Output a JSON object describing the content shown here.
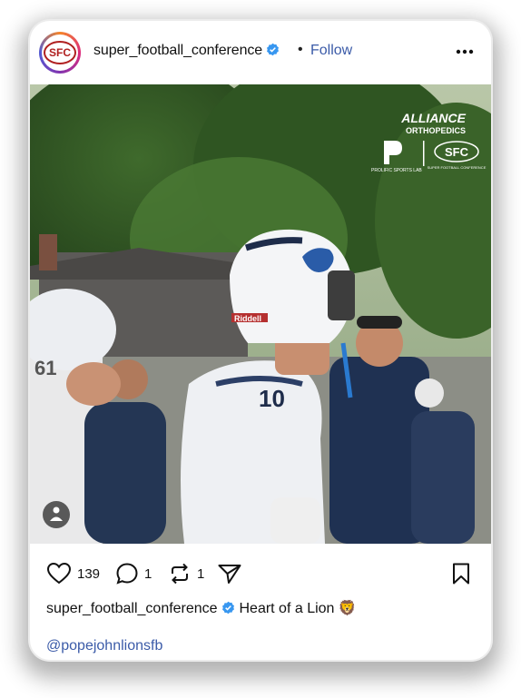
{
  "post": {
    "username": "super_football_conference",
    "follow_label": "Follow",
    "separator": "•",
    "avatar_text": "SFC"
  },
  "media": {
    "sponsor_line1": "ALLIANCE",
    "sponsor_line2": "ORTHOPEDICS",
    "sponsor_lab": "PROLIFIC SPORTS LAB",
    "conference_logo": "SFC",
    "conference_sub": "SUPER FOOTBALL CONFERENCE",
    "jersey_number": "10",
    "helmet_brand": "Riddell",
    "near_jersey_number": "61"
  },
  "actions": {
    "likes": "139",
    "comments": "1",
    "reposts": "1"
  },
  "caption": {
    "username": "super_football_conference",
    "text": "Heart of a Lion 🦁",
    "mention": "@popejohnlionsfb"
  },
  "colors": {
    "link_blue": "#3b5ba8",
    "verified_blue": "#3897f0"
  }
}
